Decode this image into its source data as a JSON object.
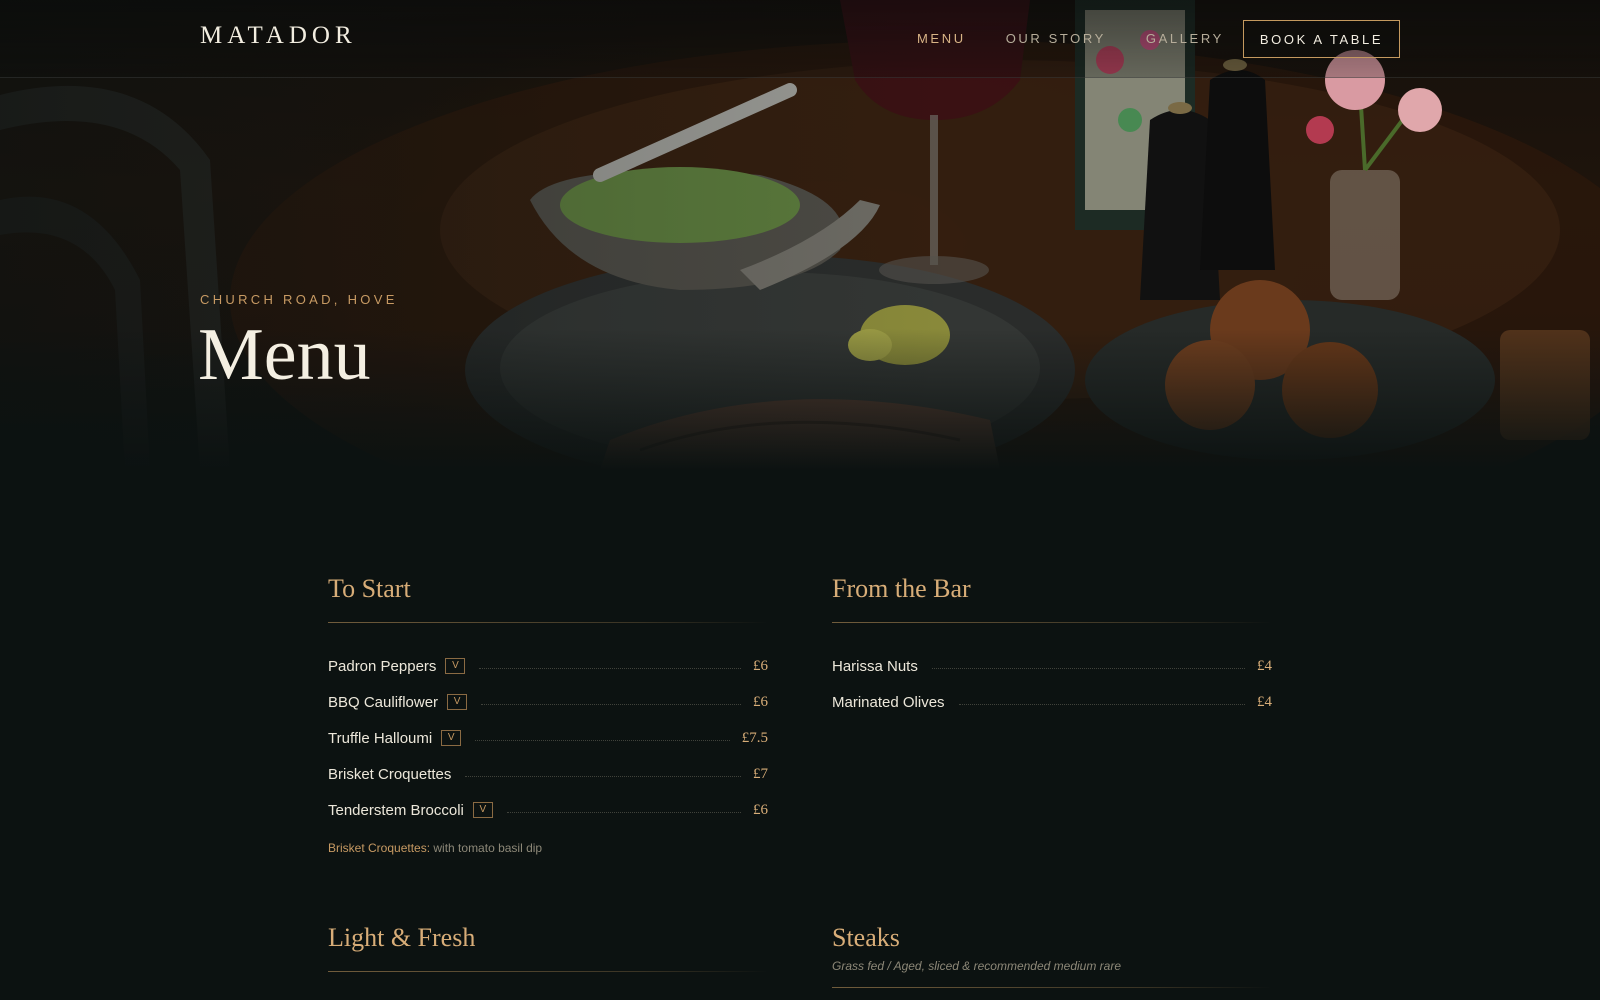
{
  "nav": {
    "logo": "MATADOR",
    "links": [
      {
        "label": "MENU",
        "active": true
      },
      {
        "label": "OUR STORY",
        "active": false
      },
      {
        "label": "GALLERY",
        "active": false
      }
    ],
    "cta": "BOOK A TABLE"
  },
  "hero": {
    "eyebrow": "CHURCH ROAD, HOVE",
    "title": "Menu"
  },
  "sections": [
    {
      "title": "To Start",
      "items": [
        {
          "name": "Padron Peppers",
          "badge": "V",
          "price": "£6"
        },
        {
          "name": "BBQ Cauliflower",
          "badge": "V",
          "price": "£6"
        },
        {
          "name": "Truffle Halloumi",
          "badge": "V",
          "price": "£7.5"
        },
        {
          "name": "Brisket Croquettes",
          "price": "£7"
        },
        {
          "name": "Tenderstem Broccoli",
          "badge": "V",
          "price": "£6"
        }
      ],
      "note": {
        "key": "Brisket Croquettes:",
        "text": " with tomato basil dip"
      }
    },
    {
      "title": "From the Bar",
      "items": [
        {
          "name": "Harissa Nuts",
          "price": "£4"
        },
        {
          "name": "Marinated Olives",
          "price": "£4"
        }
      ]
    },
    {
      "title": "Light & Fresh"
    },
    {
      "title": "Steaks",
      "subtitle": "Grass fed / Aged, sliced & recommended medium rare"
    }
  ],
  "colors": {
    "background": "#0c1211",
    "accent": "#d8ad78",
    "button_border": "#c4995f",
    "text": "#ece7da"
  }
}
